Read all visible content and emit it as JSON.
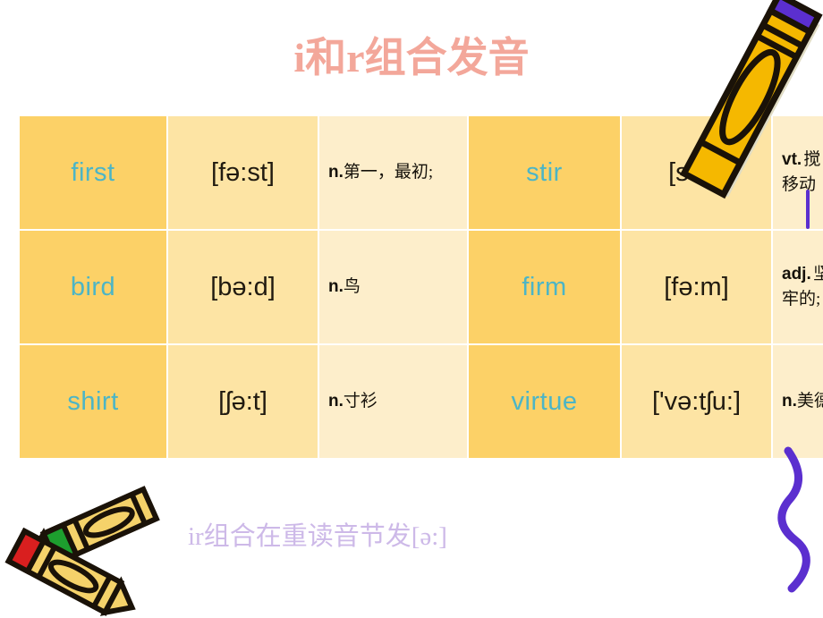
{
  "slide": {
    "title": "i和r组合发音",
    "title_color": "#f3a79a",
    "background_color": "#ffffff",
    "caption": "ir组合在重读音节发[ə:]",
    "caption_color": "#cdb9e8"
  },
  "palette": {
    "word_cell": "#fcd167",
    "ipa_cell": "#fde4a4",
    "meaning_cell": "#fdeecb",
    "word_text": "#4cb5c6",
    "ipa_text": "#201a10",
    "meaning_text": "#15110a",
    "crayon_body": "#f5b800",
    "crayon_outline": "#1a1208",
    "purple": "#5b2fcf"
  },
  "table": {
    "rows": [
      {
        "left": {
          "word": "first",
          "ipa": "[fə:st]",
          "pos": "n.",
          "meaning": "第一，最初;"
        },
        "right": {
          "word": "stir",
          "ipa": "[stə:]",
          "pos": "vt.",
          "meaning": "搅拌；（使）移动"
        }
      },
      {
        "left": {
          "word": "bird",
          "ipa": "[bə:d]",
          "pos": "n.",
          "meaning": "鸟"
        },
        "right": {
          "word": "firm",
          "ipa": "[fə:m]",
          "pos": "adj.",
          "meaning": "坚固的，坚牢的;"
        }
      },
      {
        "left": {
          "word": "shirt",
          "ipa": "[ʃə:t]",
          "pos": "n.",
          "meaning": "寸衫"
        },
        "right": {
          "word": "virtue",
          "ipa": "['və:tʃu:]",
          "pos": "n.",
          "meaning": "美德;德行"
        }
      }
    ]
  },
  "decorations": [
    {
      "name": "crayon-top-right",
      "description": "yellow crayon with purple tip, diagonal"
    },
    {
      "name": "crayons-bottom-left",
      "description": "two crossed yellow crayons, green tip and red tip"
    },
    {
      "name": "squiggle-bottom-right",
      "description": "purple wavy line"
    },
    {
      "name": "tick-right-edge",
      "description": "thin purple vertical mark"
    }
  ]
}
